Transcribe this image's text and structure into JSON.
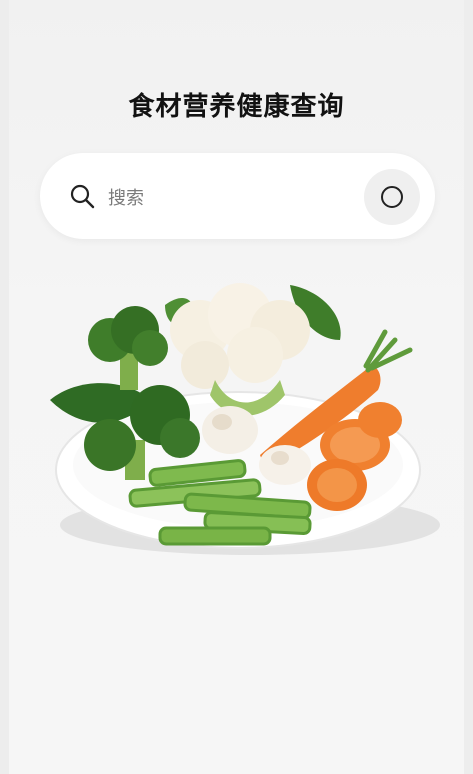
{
  "page": {
    "title": "食材营养健康查询"
  },
  "search": {
    "placeholder": "搜索"
  },
  "illustration": {
    "subject": "plate-of-vegetables"
  },
  "colors": {
    "background": "#f3f3f3",
    "search_bg": "#ffffff",
    "action_bg": "#efefef",
    "carrot": "#ef7d2d",
    "broccoli": "#3f7d2a"
  }
}
